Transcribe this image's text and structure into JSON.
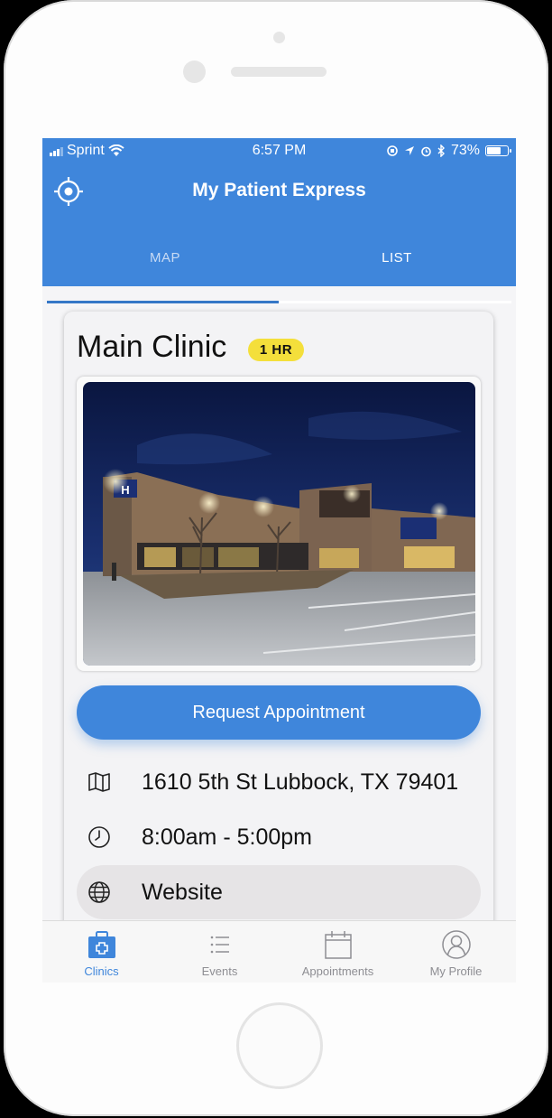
{
  "status_bar": {
    "carrier": "Sprint",
    "time": "6:57 PM",
    "battery": "73%",
    "battery_level": 0.73
  },
  "app_bar": {
    "title": "My Patient Express",
    "locate_icon": "crosshair-icon"
  },
  "tabs": [
    {
      "label": "MAP",
      "active": false
    },
    {
      "label": "LIST",
      "active": true
    }
  ],
  "clinic": {
    "name": "Main Clinic",
    "wait_badge": "1 HR",
    "photo_alt": "Clinic exterior at night",
    "request_button": "Request Appointment",
    "address": "1610 5th St Lubbock, TX 79401",
    "hours": "8:00am - 5:00pm",
    "website_label": "Website",
    "address_icon": "map-icon",
    "hours_icon": "clock-icon",
    "website_icon": "globe-icon"
  },
  "tab_bar": [
    {
      "label": "Clinics",
      "icon": "medical-kit-icon",
      "active": true
    },
    {
      "label": "Events",
      "icon": "list-icon",
      "active": false
    },
    {
      "label": "Appointments",
      "icon": "calendar-icon",
      "active": false
    },
    {
      "label": "My Profile",
      "icon": "profile-icon",
      "active": false
    }
  ],
  "colors": {
    "primary": "#3f86db",
    "badge": "#f4df3b"
  }
}
